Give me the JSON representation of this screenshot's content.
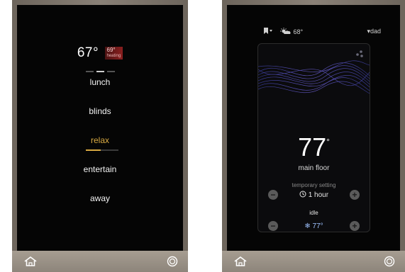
{
  "left_device": {
    "current_temp": "67°",
    "heating_setpoint": "69°",
    "heating_label": "heating",
    "menu": [
      {
        "label": "lunch"
      },
      {
        "label": "blinds"
      },
      {
        "label": "relax"
      },
      {
        "label": "entertain"
      },
      {
        "label": "away"
      }
    ],
    "active_index": 2,
    "active_progress": 0.45
  },
  "right_device": {
    "status_temp": "68°",
    "user": "dad",
    "room_temp": "77",
    "room_temp_degree": "°",
    "room_name": "main floor",
    "temporary_label": "temporary setting",
    "temporary_value": "1 hour",
    "mode": "idle",
    "setpoint": "77°"
  },
  "icons": {
    "home": "home-icon",
    "power": "power-icon",
    "bookmark": "bookmark-icon",
    "weather": "partly-cloudy-icon",
    "clock": "clock-icon",
    "snowflake": "snowflake-icon",
    "dots": "dots-icon"
  },
  "colors": {
    "accent": "#d8a942",
    "heating": "#8a1f1f",
    "cool": "#9ec2ff",
    "frame": "#8a8177"
  }
}
